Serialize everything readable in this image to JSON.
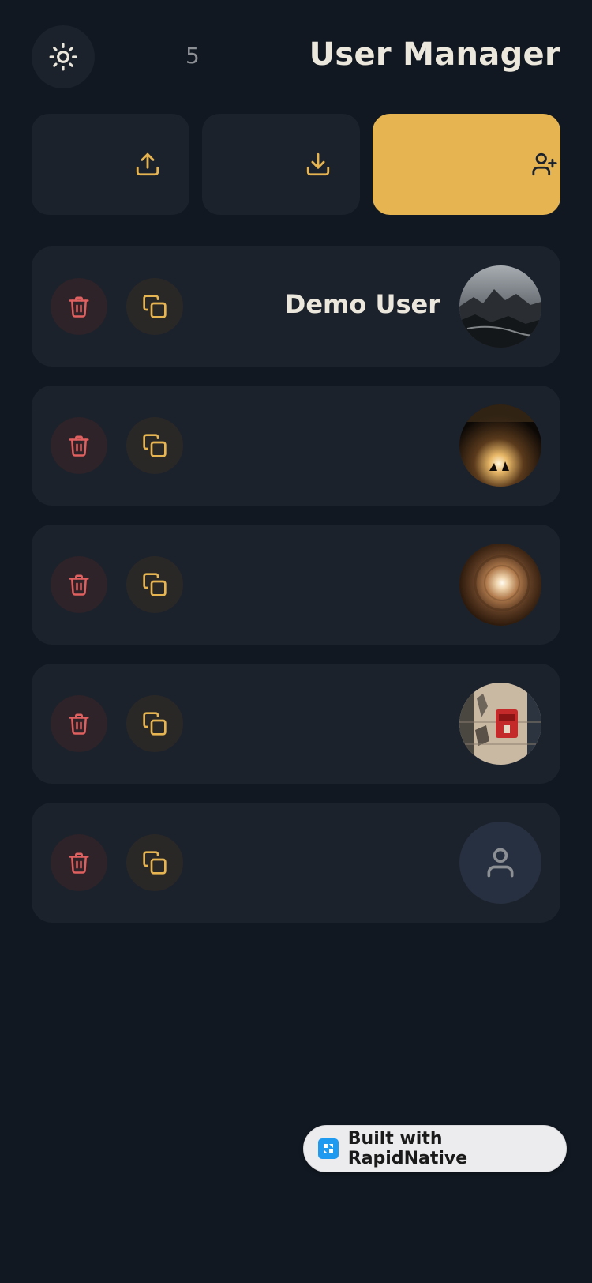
{
  "header": {
    "theme_icon": "sun-icon",
    "count": "5",
    "title": "User Manager"
  },
  "toolbar": {
    "export_icon": "upload-icon",
    "import_icon": "download-icon",
    "add_icon": "user-plus-icon",
    "accent_color": "#e6b450"
  },
  "users": [
    {
      "name": "Demo User",
      "avatar": "photo-rocky-seashore"
    },
    {
      "name": "",
      "avatar": "photo-dark-cave-light"
    },
    {
      "name": "",
      "avatar": "photo-glowing-tunnel"
    },
    {
      "name": "",
      "avatar": "photo-red-box-on-wall"
    },
    {
      "name": "",
      "avatar": "person-placeholder-icon"
    }
  ],
  "row_actions": {
    "delete_icon": "trash-icon",
    "delete_color": "#e0605f",
    "copy_icon": "copy-icon",
    "copy_color": "#e6b450"
  },
  "badge": {
    "label": "Built with RapidNative",
    "logo_color": "#1e9bf0"
  }
}
